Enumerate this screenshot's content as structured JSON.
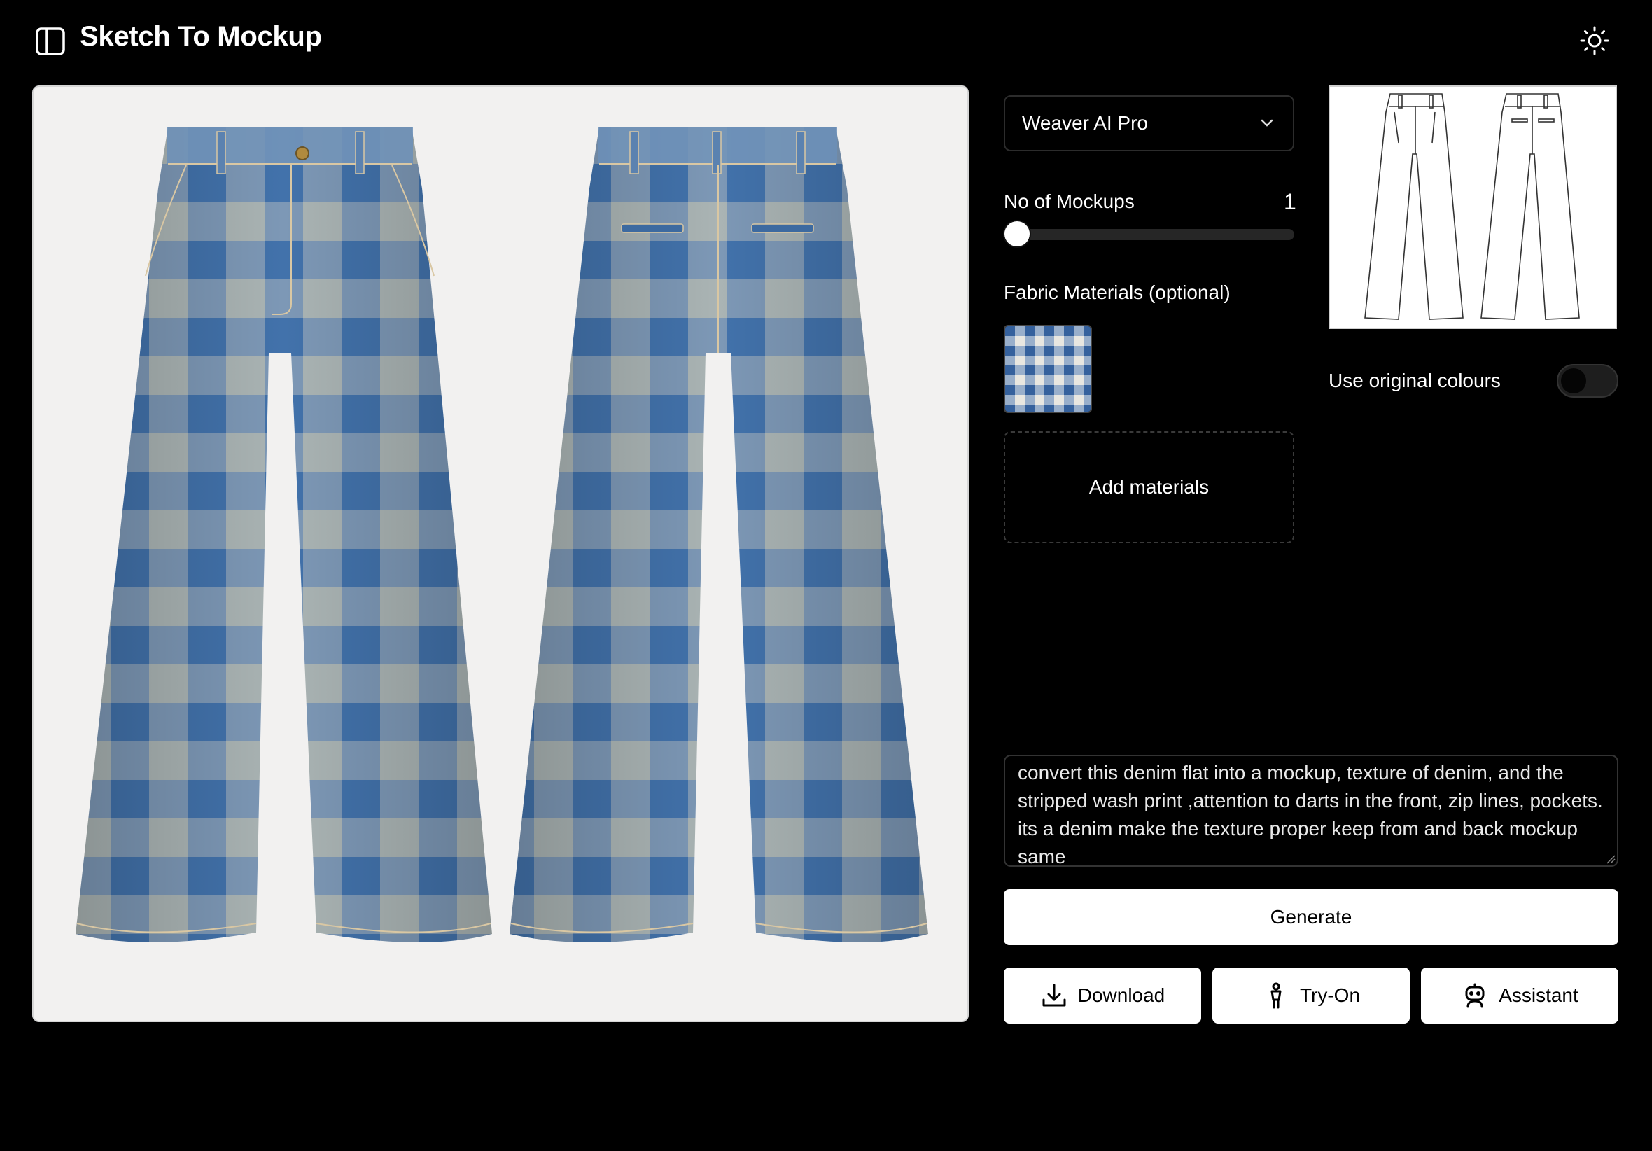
{
  "header": {
    "title": "Sketch To Mockup",
    "sidebar_icon": "sidebar-panel-icon",
    "theme_icon": "sun-icon"
  },
  "settings": {
    "model_select": {
      "value": "Weaver AI Pro",
      "icon": "chevron-down-icon"
    },
    "mockups_slider": {
      "label": "No of Mockups",
      "value": "1"
    },
    "fabric": {
      "label": "Fabric Materials (optional)",
      "add_label": "Add materials"
    },
    "original_colours": {
      "label": "Use original colours",
      "enabled": false
    }
  },
  "prompt": {
    "value": "convert this denim flat into a mockup, texture of denim, and the stripped wash print ,attention to darts in the front, zip lines, pockets. its a denim make the texture proper keep from and back mockup same"
  },
  "actions": {
    "generate": "Generate",
    "download": "Download",
    "tryon": "Try-On",
    "assistant": "Assistant"
  },
  "colors": {
    "background": "#000000",
    "denim_dark": "#4a7bb3",
    "denim_light": "#a9b3b3",
    "button": "#ffffff"
  }
}
